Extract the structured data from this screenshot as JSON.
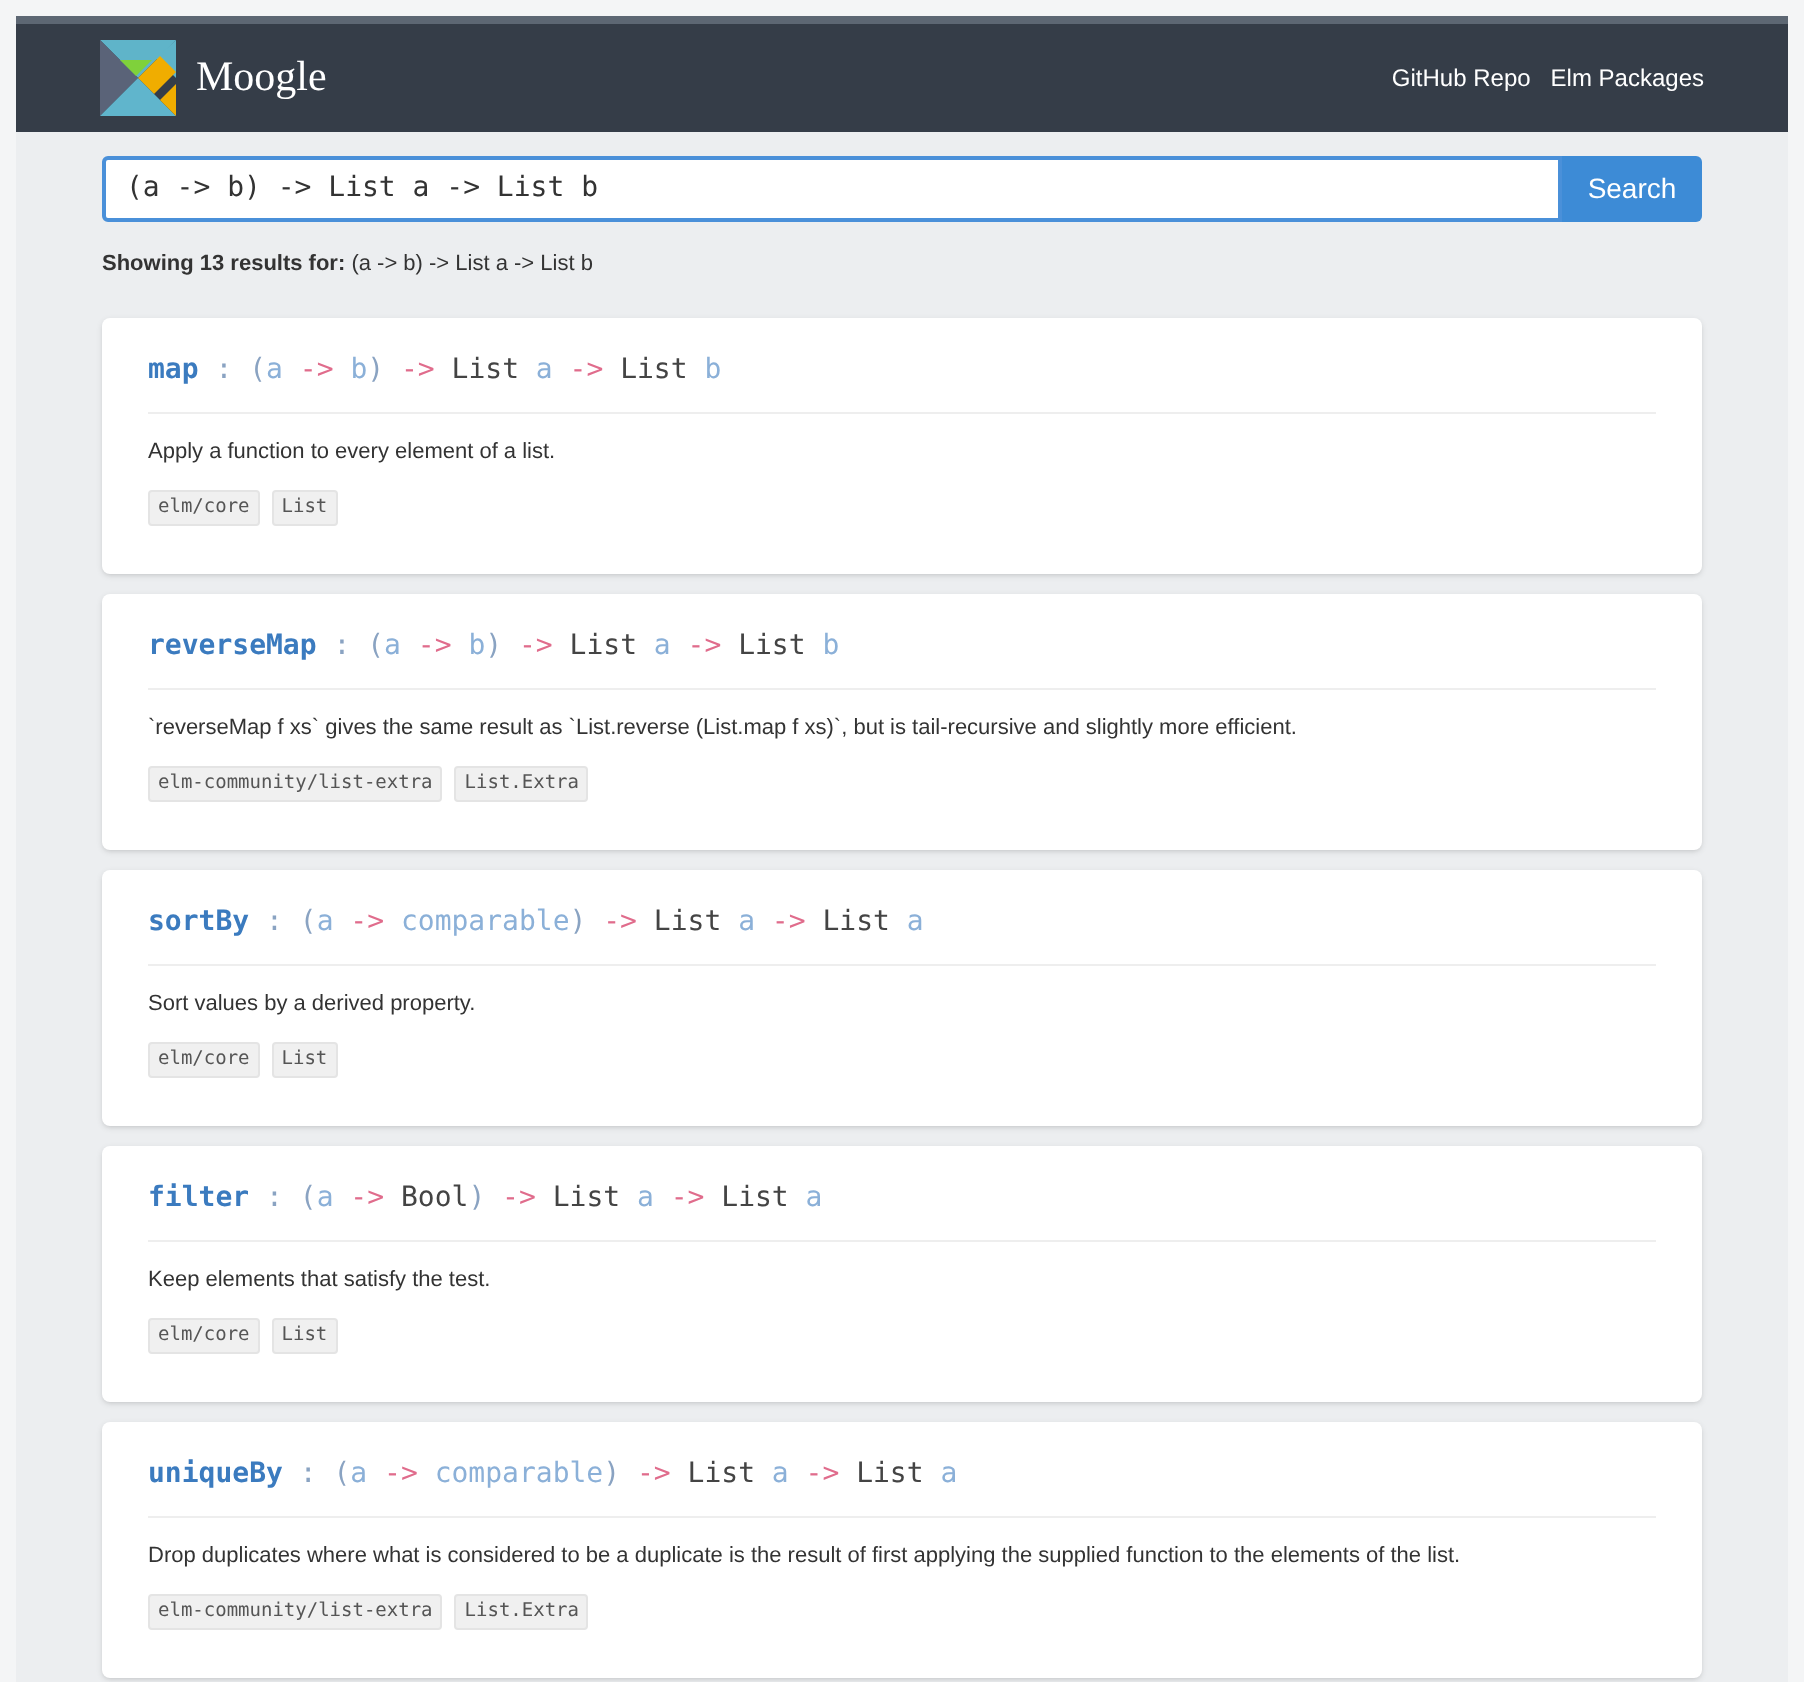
{
  "header": {
    "brand": "Moogle",
    "links": [
      "GitHub Repo",
      "Elm Packages"
    ]
  },
  "search": {
    "value": "(a -> b) -> List a -> List b",
    "button": "Search"
  },
  "summary": {
    "label": "Showing 13 results for:",
    "query": "(a -> b) -> List a -> List b"
  },
  "results": [
    {
      "signature": [
        {
          "text": "map",
          "kind": "name"
        },
        {
          "text": " : ",
          "kind": "punct"
        },
        {
          "text": "(",
          "kind": "punct"
        },
        {
          "text": "a",
          "kind": "var"
        },
        {
          "text": " -> ",
          "kind": "arrow"
        },
        {
          "text": "b",
          "kind": "var"
        },
        {
          "text": ")",
          "kind": "punct"
        },
        {
          "text": " -> ",
          "kind": "arrow"
        },
        {
          "text": "List",
          "kind": "type"
        },
        {
          "text": " a",
          "kind": "var"
        },
        {
          "text": " -> ",
          "kind": "arrow"
        },
        {
          "text": "List",
          "kind": "type"
        },
        {
          "text": " b",
          "kind": "var"
        }
      ],
      "description": "Apply a function to every element of a list.",
      "tags": [
        "elm/core",
        "List"
      ]
    },
    {
      "signature": [
        {
          "text": "reverseMap",
          "kind": "name"
        },
        {
          "text": " : ",
          "kind": "punct"
        },
        {
          "text": "(",
          "kind": "punct"
        },
        {
          "text": "a",
          "kind": "var"
        },
        {
          "text": " -> ",
          "kind": "arrow"
        },
        {
          "text": "b",
          "kind": "var"
        },
        {
          "text": ")",
          "kind": "punct"
        },
        {
          "text": " -> ",
          "kind": "arrow"
        },
        {
          "text": "List",
          "kind": "type"
        },
        {
          "text": " a",
          "kind": "var"
        },
        {
          "text": " -> ",
          "kind": "arrow"
        },
        {
          "text": "List",
          "kind": "type"
        },
        {
          "text": " b",
          "kind": "var"
        }
      ],
      "description": "`reverseMap f xs` gives the same result as `List.reverse (List.map f xs)`, but is tail-recursive and slightly more efficient.",
      "tags": [
        "elm-community/list-extra",
        "List.Extra"
      ]
    },
    {
      "signature": [
        {
          "text": "sortBy",
          "kind": "name"
        },
        {
          "text": " : ",
          "kind": "punct"
        },
        {
          "text": "(",
          "kind": "punct"
        },
        {
          "text": "a",
          "kind": "var"
        },
        {
          "text": " -> ",
          "kind": "arrow"
        },
        {
          "text": "comparable",
          "kind": "var"
        },
        {
          "text": ")",
          "kind": "punct"
        },
        {
          "text": " -> ",
          "kind": "arrow"
        },
        {
          "text": "List",
          "kind": "type"
        },
        {
          "text": " a",
          "kind": "var"
        },
        {
          "text": " -> ",
          "kind": "arrow"
        },
        {
          "text": "List",
          "kind": "type"
        },
        {
          "text": " a",
          "kind": "var"
        }
      ],
      "description": "Sort values by a derived property.",
      "tags": [
        "elm/core",
        "List"
      ]
    },
    {
      "signature": [
        {
          "text": "filter",
          "kind": "name"
        },
        {
          "text": " : ",
          "kind": "punct"
        },
        {
          "text": "(",
          "kind": "punct"
        },
        {
          "text": "a",
          "kind": "var"
        },
        {
          "text": " -> ",
          "kind": "arrow"
        },
        {
          "text": "Bool",
          "kind": "type"
        },
        {
          "text": ")",
          "kind": "punct"
        },
        {
          "text": " -> ",
          "kind": "arrow"
        },
        {
          "text": "List",
          "kind": "type"
        },
        {
          "text": " a",
          "kind": "var"
        },
        {
          "text": " -> ",
          "kind": "arrow"
        },
        {
          "text": "List",
          "kind": "type"
        },
        {
          "text": " a",
          "kind": "var"
        }
      ],
      "description": "Keep elements that satisfy the test.",
      "tags": [
        "elm/core",
        "List"
      ]
    },
    {
      "signature": [
        {
          "text": "uniqueBy",
          "kind": "name"
        },
        {
          "text": " : ",
          "kind": "punct"
        },
        {
          "text": "(",
          "kind": "punct"
        },
        {
          "text": "a",
          "kind": "var"
        },
        {
          "text": " -> ",
          "kind": "arrow"
        },
        {
          "text": "comparable",
          "kind": "var"
        },
        {
          "text": ")",
          "kind": "punct"
        },
        {
          "text": " -> ",
          "kind": "arrow"
        },
        {
          "text": "List",
          "kind": "type"
        },
        {
          "text": " a",
          "kind": "var"
        },
        {
          "text": " -> ",
          "kind": "arrow"
        },
        {
          "text": "List",
          "kind": "type"
        },
        {
          "text": " a",
          "kind": "var"
        }
      ],
      "description": "Drop duplicates where what is considered to be a duplicate is the result of first applying the supplied function to the elements of the list.",
      "tags": [
        "elm-community/list-extra",
        "List.Extra"
      ]
    }
  ]
}
